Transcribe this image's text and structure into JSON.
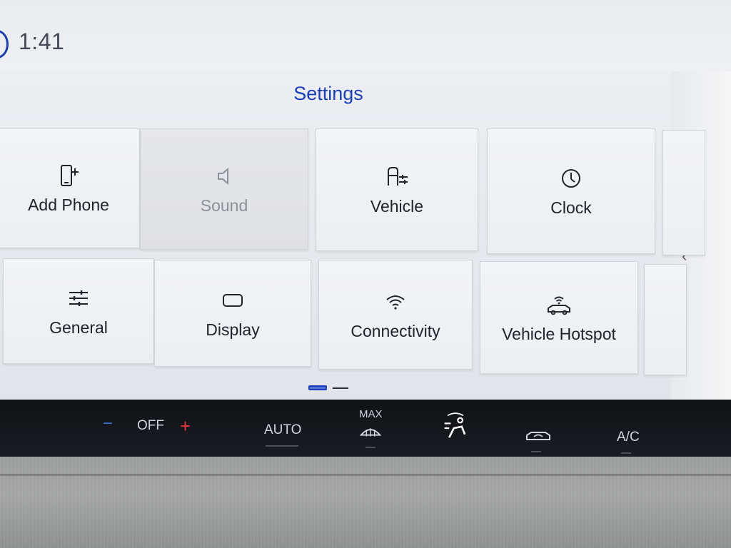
{
  "status": {
    "time": "1:41"
  },
  "page": {
    "title": "Settings"
  },
  "tiles": [
    {
      "label": "Add Phone",
      "icon": "add-phone-icon"
    },
    {
      "label": "Sound",
      "icon": "speaker-icon",
      "state": "disabled"
    },
    {
      "label": "Vehicle",
      "icon": "vehicle-settings-icon"
    },
    {
      "label": "Clock",
      "icon": "clock-icon"
    },
    {
      "label": "General",
      "icon": "sliders-icon"
    },
    {
      "label": "Display",
      "icon": "display-icon"
    },
    {
      "label": "Connectivity",
      "icon": "wifi-icon"
    },
    {
      "label": "Vehicle Hotspot",
      "icon": "hotspot-icon"
    }
  ],
  "pager": {
    "pages": 2,
    "current": 1
  },
  "climate": {
    "fan_label": "OFF",
    "minus": "−",
    "plus": "+",
    "auto_label": "AUTO",
    "max_label": "MAX",
    "ac_label": "A/C"
  },
  "colors": {
    "accent": "#1b3fb5",
    "minus": "#3b6fd8",
    "plus": "#e0333a"
  }
}
